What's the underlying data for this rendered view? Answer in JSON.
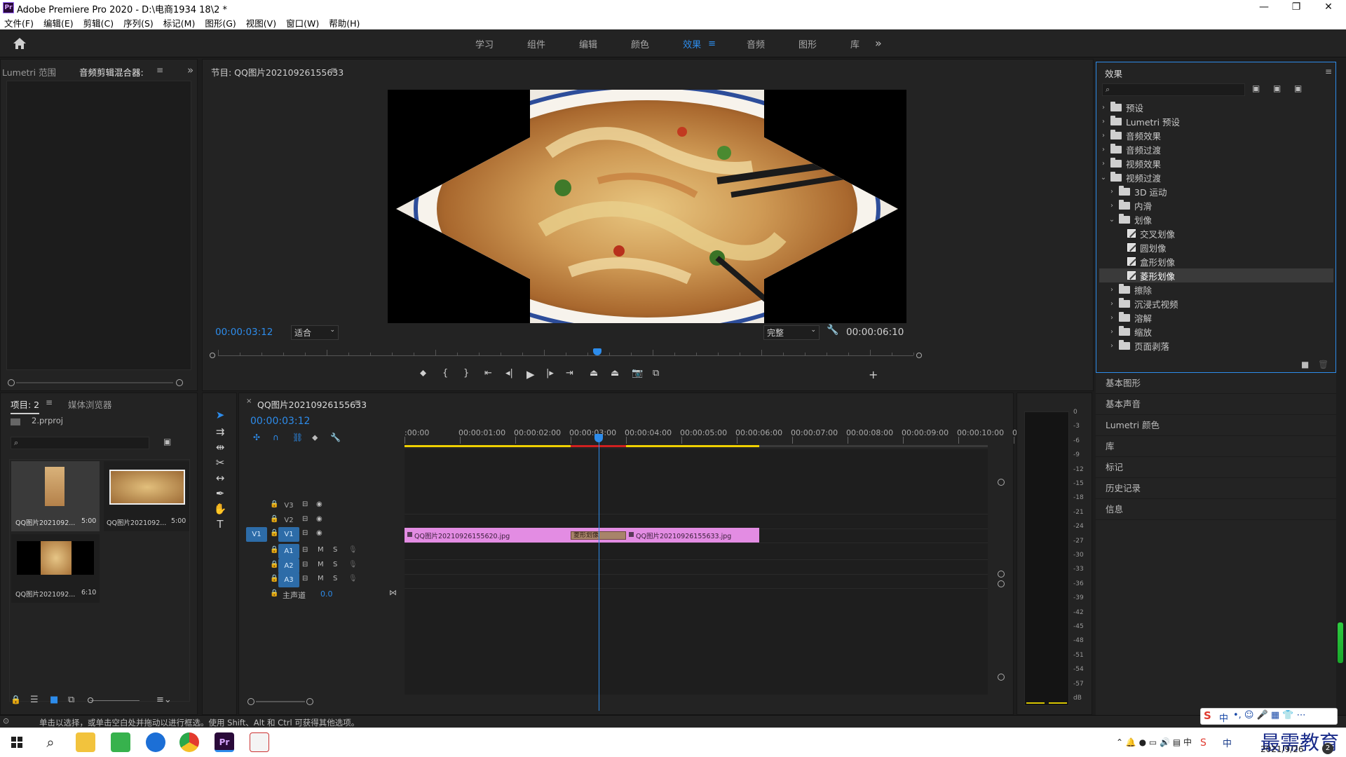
{
  "titlebar": {
    "app_title": "Adobe Premiere Pro 2020 - D:\\电商1934 18\\2 *",
    "app_icon": "Pr",
    "minimize": "—",
    "maximize": "❐",
    "close": "✕"
  },
  "menu": [
    "文件(F)",
    "编辑(E)",
    "剪辑(C)",
    "序列(S)",
    "标记(M)",
    "图形(G)",
    "视图(V)",
    "窗口(W)",
    "帮助(H)"
  ],
  "workspaces": {
    "tabs": [
      "学习",
      "组件",
      "编辑",
      "颜色",
      "效果",
      "音频",
      "图形",
      "库"
    ],
    "active": "效果",
    "more": "»"
  },
  "left_top": {
    "tabs": [
      "Lumetri 范围",
      "音频剪辑混合器:"
    ],
    "more": "»"
  },
  "program": {
    "title": "节目: QQ图片20210926155633",
    "current_time": "00:00:03:12",
    "fit": "适合",
    "quality": "完整",
    "duration": "00:00:06:10",
    "playhead_fraction": 0.545,
    "controls": [
      "marker-icon",
      "in-point-icon",
      "out-point-icon",
      "go-to-in-icon",
      "step-back-icon",
      "play-icon",
      "step-forward-icon",
      "go-to-out-icon",
      "lift-icon",
      "extract-icon",
      "export-frame-icon",
      "compare-icon"
    ],
    "add": "+"
  },
  "effects": {
    "title": "效果",
    "search_placeholder": "",
    "tree": [
      {
        "label": "预设",
        "type": "folder-special",
        "level": 0,
        "open": false
      },
      {
        "label": "Lumetri 预设",
        "type": "folder-special",
        "level": 0,
        "open": false
      },
      {
        "label": "音频效果",
        "type": "folder",
        "level": 0,
        "open": false
      },
      {
        "label": "音频过渡",
        "type": "folder",
        "level": 0,
        "open": false
      },
      {
        "label": "视频效果",
        "type": "folder",
        "level": 0,
        "open": false
      },
      {
        "label": "视频过渡",
        "type": "folder",
        "level": 0,
        "open": true
      },
      {
        "label": "3D 运动",
        "type": "folder",
        "level": 1,
        "open": false
      },
      {
        "label": "内滑",
        "type": "folder",
        "level": 1,
        "open": false
      },
      {
        "label": "划像",
        "type": "folder",
        "level": 1,
        "open": true
      },
      {
        "label": "交叉划像",
        "type": "effect",
        "level": 2
      },
      {
        "label": "圆划像",
        "type": "effect",
        "level": 2
      },
      {
        "label": "盒形划像",
        "type": "effect",
        "level": 2
      },
      {
        "label": "菱形划像",
        "type": "effect",
        "level": 2,
        "selected": true
      },
      {
        "label": "擦除",
        "type": "folder",
        "level": 1,
        "open": false
      },
      {
        "label": "沉浸式视频",
        "type": "folder",
        "level": 1,
        "open": false
      },
      {
        "label": "溶解",
        "type": "folder",
        "level": 1,
        "open": false
      },
      {
        "label": "缩放",
        "type": "folder",
        "level": 1,
        "open": false
      },
      {
        "label": "页面剥落",
        "type": "folder",
        "level": 1,
        "open": false
      }
    ]
  },
  "right_panels": [
    "基本图形",
    "基本声音",
    "Lumetri 颜色",
    "库",
    "标记",
    "历史记录",
    "信息"
  ],
  "project": {
    "tabs": [
      "项目: 2",
      "媒体浏览器"
    ],
    "file": "2.prproj",
    "items": [
      {
        "name": "QQ图片2021092...",
        "duration": "5:00"
      },
      {
        "name": "QQ图片2021092...",
        "duration": "5:00"
      },
      {
        "name": "QQ图片2021092...",
        "duration": "6:10"
      }
    ]
  },
  "timeline": {
    "tab": "QQ图片20210926155633",
    "current_time": "00:00:03:12",
    "ruler": [
      ":00:00",
      "00:00:01:00",
      "00:00:02:00",
      "00:00:03:00",
      "00:00:04:00",
      "00:00:05:00",
      "00:00:06:00",
      "00:00:07:00",
      "00:00:08:00",
      "00:00:09:00",
      "00:00:10:00",
      "0"
    ],
    "video_tracks": [
      "V3",
      "V2",
      "V1"
    ],
    "source_patch": "V1",
    "audio_tracks": [
      "A1",
      "A2",
      "A3"
    ],
    "master": {
      "label": "主声道",
      "value": "0.0"
    },
    "mute": "M",
    "solo": "S",
    "clips": [
      {
        "name": "QQ图片20210926155620.jpg",
        "start_sec": 0,
        "end_sec": 3.0
      },
      {
        "name": "QQ图片20210926155633.jpg",
        "start_sec": 4.0,
        "end_sec": 6.4
      }
    ],
    "transition": {
      "name": "菱形划像",
      "start_sec": 3.0,
      "end_sec": 4.0
    },
    "playhead_sec": 3.5
  },
  "meter": {
    "labels": [
      "0",
      "-3",
      "-6",
      "-9",
      "-12",
      "-15",
      "-18",
      "-21",
      "-24",
      "-27",
      "-30",
      "-33",
      "-36",
      "-39",
      "-42",
      "-45",
      "-48",
      "-51",
      "-54",
      "-57",
      "dB"
    ]
  },
  "status": {
    "text": "单击以选择，或单击空白处并拖动以进行框选。使用 Shift、Alt 和 Ctrl 可获得其他选项。"
  },
  "taskbar": {
    "apps": [
      "windows-start-icon",
      "search-icon",
      "file-explorer-icon",
      "app-store-icon",
      "browser-icon",
      "chrome-icon",
      "premiere-icon",
      "paint-icon"
    ],
    "date": "2021/9/26",
    "watermark": "最需教育",
    "ime": "中",
    "badge": "2"
  },
  "colors": {
    "accent": "#2d8ceb",
    "clip": "#e38ce3",
    "panel": "#232323",
    "work_area": "#f0d000",
    "render_red": "#d02020"
  }
}
